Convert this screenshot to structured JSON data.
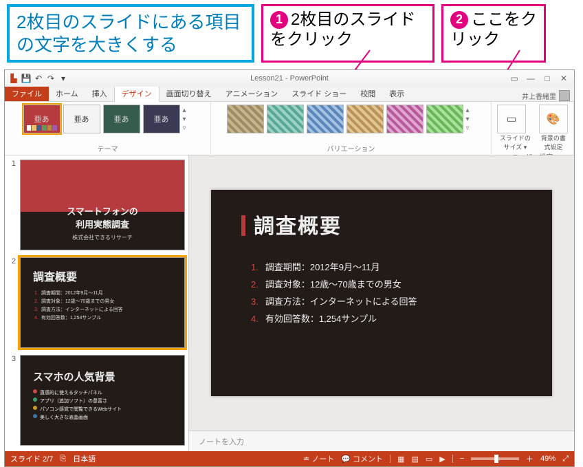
{
  "annotations": {
    "blue": "2枚目のスライドにある項目の文字を大きくする",
    "pink1": "2枚目のスライドをクリック",
    "pink2": "ここをクリック"
  },
  "titlebar": {
    "title": "Lesson21 - PowerPoint",
    "user": "井上香緒里"
  },
  "tabs": {
    "file": "ファイル",
    "home": "ホーム",
    "insert": "挿入",
    "design": "デザイン",
    "transitions": "画面切り替え",
    "animations": "アニメーション",
    "slideshow": "スライド ショー",
    "review": "校閲",
    "view": "表示"
  },
  "ribbon": {
    "theme_glyph": "亜あ",
    "themes_label": "テーマ",
    "variations_label": "バリエーション",
    "user_label": "ユーザー設定",
    "slide_size": "スライドのサイズ ▾",
    "bg_format": "背景の書式設定"
  },
  "variation_colors": [
    "#9f8b67",
    "#5aa796",
    "#5b88b9",
    "#b9935b",
    "#b65b9a",
    "#6bb65b"
  ],
  "thumbs": {
    "s1_title": "スマートフォンの",
    "s1_title2": "利用実態調査",
    "s1_sub": "株式会社できるリサーチ",
    "s2_title": "調査概要",
    "s2_items": [
      "調査期間：2012年9月～11月",
      "調査対象：12歳～70歳までの男女",
      "調査方法：インターネットによる回答",
      "有効回答数：1,254サンプル"
    ],
    "s3_title": "スマホの人気背景",
    "s3_items": [
      {
        "c": "#c94848",
        "t": "直感的に使えるタッチパネル"
      },
      {
        "c": "#3aa36a",
        "t": "アプリ（追加ソフト）の豊富さ"
      },
      {
        "c": "#cc9a2c",
        "t": "パソコン感覚で閲覧できるWebサイト"
      },
      {
        "c": "#3a74a3",
        "t": "美しく大きな液晶画面"
      }
    ]
  },
  "slide": {
    "title": "調査概要",
    "items": [
      "調査期間：2012年9月～11月",
      "調査対象：12歳～70歳までの男女",
      "調査方法：インターネットによる回答",
      "有効回答数：1,254サンプル"
    ]
  },
  "notes_placeholder": "ノートを入力",
  "status": {
    "slide": "スライド 2/7",
    "lang": "日本語",
    "notes": "ノート",
    "comments": "コメント",
    "zoom": "49%"
  }
}
